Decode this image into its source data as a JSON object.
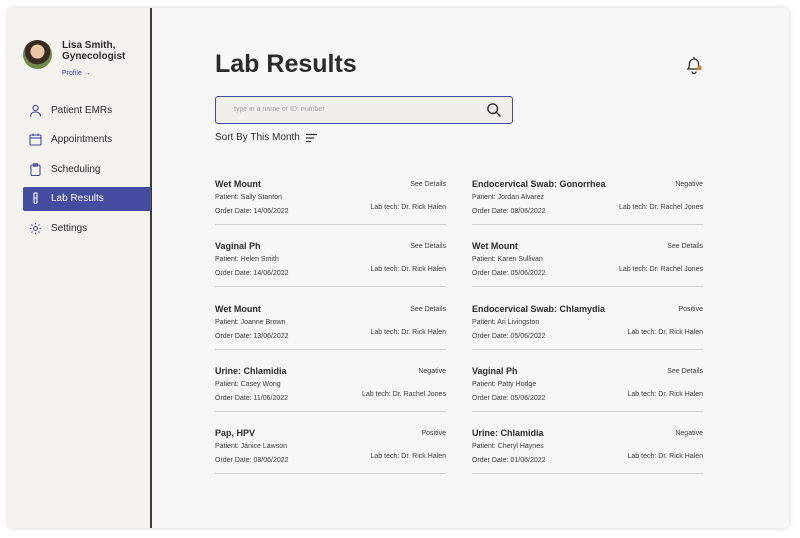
{
  "profile": {
    "name": "Lisa Smith, Gynecologist",
    "link": "Profile →"
  },
  "nav": [
    {
      "label": "Patient EMRs",
      "icon": "person-icon",
      "active": false
    },
    {
      "label": "Appointments",
      "icon": "calendar-icon",
      "active": false
    },
    {
      "label": "Scheduling",
      "icon": "clipboard-icon",
      "active": false
    },
    {
      "label": "Lab Results",
      "icon": "test-tube-icon",
      "active": true
    },
    {
      "label": "Settings",
      "icon": "gear-icon",
      "active": false
    }
  ],
  "header": {
    "title": "Lab Results",
    "bell_icon": "bell-icon",
    "notification_color": "#e0762b"
  },
  "search": {
    "placeholder": "type in a name or ID: number",
    "value": ""
  },
  "sort": {
    "label": "Sort By This Month"
  },
  "colors": {
    "accent": "#434c9e",
    "sidebar_bg": "#f4f2ec"
  },
  "results": [
    {
      "name": "Wet Mount",
      "status": "See Details",
      "patient": "Patient: Sally Stanton",
      "labtech": "Lab tech: Dr. Rick Halen",
      "order": "Order Date: 14/06/2022"
    },
    {
      "name": "Endocervical Swab: Gonorrhea",
      "status": "Negative",
      "patient": "Patient: Jordan Alvarez",
      "labtech": "Lab tech: Dr. Rachel Jones",
      "order": "Order Date: 08/06/2022"
    },
    {
      "name": "Vaginal Ph",
      "status": "See Details",
      "patient": "Patient: Helen Smith",
      "labtech": "Lab tech: Dr. Rick Halen",
      "order": "Order Date: 14/06/2022"
    },
    {
      "name": "Wet Mount",
      "status": "See Details",
      "patient": "Patient: Karen Sullivan",
      "labtech": "Lab tech: Dr. Rachel Jones",
      "order": "Order Date: 05/06/2022"
    },
    {
      "name": "Wet Mount",
      "status": "See Details",
      "patient": "Patient: Joanne Brown",
      "labtech": "Lab tech: Dr. Rick Halen",
      "order": "Order Date: 13/06/2022"
    },
    {
      "name": "Endocervical Swab: Chlamydia",
      "status": "Positive",
      "patient": "Patient: Ari Livingston",
      "labtech": "Lab tech: Dr. Rick Halen",
      "order": "Order Date: 05/06/2022"
    },
    {
      "name": "Urine: Chlamidia",
      "status": "Negative",
      "patient": "Patient: Casey Wong",
      "labtech": "Lab tech: Dr. Rachel Jones",
      "order": "Order Date: 11/06/2022"
    },
    {
      "name": "Vaginal Ph",
      "status": "See Details",
      "patient": "Patient: Patty Hodge",
      "labtech": "Lab tech: Dr. Rick Halen",
      "order": "Order Date: 05/06/2022"
    },
    {
      "name": "Pap, HPV",
      "status": "Positive",
      "patient": "Patient: Janice Lawson",
      "labtech": "Lab tech: Dr. Rick Halen",
      "order": "Order Date: 08/06/2022"
    },
    {
      "name": "Urine: Chlamidia",
      "status": "Negative",
      "patient": "Patient: Cheryl Haynes",
      "labtech": "Lab tech: Dr. Rick Halen",
      "order": "Order Date: 01/06/2022"
    }
  ]
}
